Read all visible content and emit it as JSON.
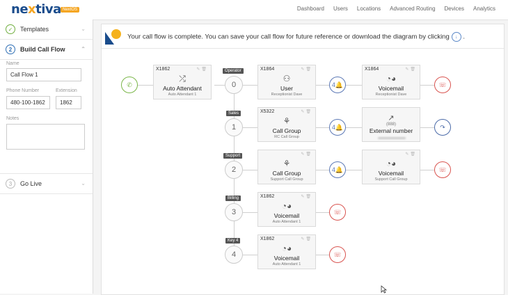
{
  "brand": {
    "name_a": "ne",
    "name_x": "x",
    "name_b": "tiva",
    "badge": "NextOS"
  },
  "nav": [
    "Dashboard",
    "Users",
    "Locations",
    "Advanced Routing",
    "Devices",
    "Analytics"
  ],
  "sidebar": {
    "steps": [
      {
        "num": "✓",
        "label": "Templates"
      },
      {
        "num": "2",
        "label": "Build Call Flow"
      },
      {
        "num": "3",
        "label": "Go Live"
      }
    ],
    "form": {
      "name_label": "Name",
      "name_value": "Call Flow 1",
      "phone_label": "Phone Number",
      "phone_value": "480-100-1862",
      "ext_label": "Extension",
      "ext_value": "1862",
      "notes_label": "Notes",
      "notes_value": ""
    }
  },
  "banner": {
    "text": "Your call flow is complete. You can save your call flow for future reference or download the diagram by clicking",
    "end": "."
  },
  "flow": {
    "attendant": {
      "ext": "X1862",
      "title": "Auto Attendant",
      "sub": "Auto Attendant 1"
    },
    "keys": [
      {
        "label": "Operator",
        "digit": "0"
      },
      {
        "label": "Sales",
        "digit": "1"
      },
      {
        "label": "Support",
        "digit": "2"
      },
      {
        "label": "Billing",
        "digit": "3"
      },
      {
        "label": "Key 4",
        "digit": "4"
      }
    ],
    "dests": [
      {
        "ext": "X1864",
        "title": "User",
        "sub": "Receptionist Dave"
      },
      {
        "ext": "X5322",
        "title": "Call Group",
        "sub": "RC Call Group"
      },
      {
        "ext": "",
        "title": "Call Group",
        "sub": "Support Call Group"
      },
      {
        "ext": "X1862",
        "title": "Voicemail",
        "sub": "Auto Attendant 1"
      },
      {
        "ext": "X1862",
        "title": "Voicemail",
        "sub": "Auto Attendant 1"
      }
    ],
    "ring_label": "4",
    "seconds": [
      {
        "ext": "X1864",
        "title": "Voicemail",
        "sub": "Receptionist Dave"
      },
      {
        "ext": "",
        "title": "External number",
        "sub": "(888)"
      },
      {
        "ext": "",
        "title": "Voicemail",
        "sub": "Support Call Group"
      }
    ]
  },
  "colors": {
    "start": "#7ab648",
    "ring": "#5b78b5",
    "hangup": "#d9534f",
    "forward": "#4a6aa8"
  }
}
